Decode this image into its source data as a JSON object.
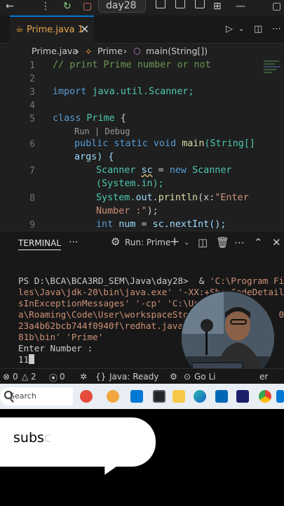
{
  "titlebar": {
    "search_text": "day28"
  },
  "tab": {
    "label": "Prime.java 1",
    "close": "✕"
  },
  "breadcrumb": {
    "file": "Prime.java",
    "class": "Prime",
    "method": "main(String[])"
  },
  "editor": {
    "line_numbers": [
      "1",
      "2",
      "3",
      "4",
      "5",
      "6",
      "7",
      "8",
      "9"
    ],
    "code_lens": "Run | Debug",
    "lines": {
      "l1": "// print Prime number or not",
      "l3_kw": "import",
      "l3_rest": "java.util.Scanner;",
      "l5_kw": "class",
      "l5_name": "Prime",
      "l5_brace": "{",
      "l6_kw": "public static void",
      "l6_fn": "main",
      "l6_rest": "(String[]",
      "l6b": "args) {",
      "l7_type": "Scanner",
      "l7_var": "sc",
      "l7_eq": " = ",
      "l7_new": "new",
      "l7_type2": "Scanner",
      "l7b": "(System.in);",
      "l8_a": "System.",
      "l8_b": "out",
      "l8_c": ".",
      "l8_fn": "println",
      "l8_d": "(x:",
      "l8_str": "\"Enter",
      "l8b_str": "Number :\"",
      "l8b_end": ");",
      "l9_kw": "int",
      "l9_var": "num",
      "l9_eq": " = ",
      "l9_rest": "sc.nextInt();"
    }
  },
  "panel": {
    "terminal_tab": "TERMINAL",
    "more": "···",
    "run_config": "Run: Prime"
  },
  "terminal": {
    "l1a": "PS D:\\BCA\\BCA3RD_SEM\\Java\\day28>  & ",
    "l1b": "'C:\\Program Fi",
    "l2": "les\\Java\\jdk-20\\bin\\java.exe' '-XX:+ShowCodeDetail",
    "l3": "sInExceptionMessages' '-cp' 'C:\\Use                Data",
    "l4": "a\\Roaming\\Code\\User\\workspaceStor                03",
    "l5": "23a4b62bcb744f0940f\\redhat.java\\                  b0",
    "l6": "81b\\bin' 'Prime'",
    "l7": "Enter Number :",
    "l8": "11"
  },
  "statusbar": {
    "errors": "0",
    "warnings": "2",
    "ports": "0",
    "java": "Java: Ready",
    "live": "Go Li",
    "ter": "er"
  },
  "taskbar": {
    "search_label": "Search"
  },
  "bubble": {
    "text": "subs",
    "faded": "c"
  },
  "colors": {
    "accent": "#0078d4",
    "editor_bg": "#1f1f1f",
    "keyword": "#569cd6",
    "type": "#4ec9b0",
    "string": "#ce9178",
    "comment": "#6a9955"
  }
}
